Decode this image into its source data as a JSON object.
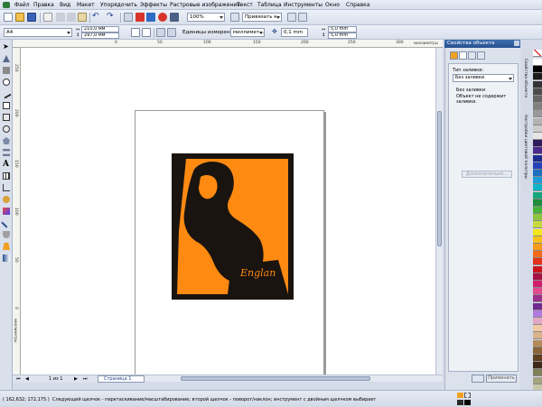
{
  "menu": [
    "Файл",
    "Правка",
    "Вид",
    "Макет",
    "Упорядочить",
    "Эффекты",
    "Растровые изображения",
    "Текст",
    "Таблица",
    "Инструменты",
    "Окно",
    "Справка"
  ],
  "toolbar": {
    "zoom": "100%",
    "snap": "Привязать к"
  },
  "propbar": {
    "page_size": "A4",
    "width": "210,0 мм",
    "height": "297,0 мм",
    "units_label": "Единицы измерения:",
    "units": "миллимет...",
    "nudge": "0,1 mm",
    "dup_x": "5,0 mm",
    "dup_y": "5,0 mm"
  },
  "ruler": {
    "h_labels": [
      "0",
      "50",
      "100",
      "150",
      "200",
      "250",
      "300"
    ],
    "h_unit": "миллиметры",
    "v_labels": [
      "250",
      "200",
      "150",
      "100",
      "50",
      "0"
    ],
    "v_unit": "миллиметры"
  },
  "docker": {
    "title": "Свойства объекта",
    "fill_type_label": "Тип заливки:",
    "fill_type": "Без заливки",
    "fill_note_title": "Без заливки",
    "fill_note": "Объект не содержит заливки.",
    "more_button": "Дополнительно...",
    "apply_button": "Применить"
  },
  "vtabs": [
    "Свойства объекта",
    "Настройки цветовой палитры"
  ],
  "pagenav": {
    "counter": "1 из 1",
    "tab": "Страница 1"
  },
  "status": {
    "coords": "( 162,632; 172,175 )",
    "hint": "Следующий щелчок - перетаскивание/масштабирование; второй щелчок - поворот/наклон; инструмент с двойным щелчком выбирает вс..."
  },
  "palette_colors": [
    "#ffffff",
    "#000000",
    "#1a1a1a",
    "#333333",
    "#4d4d4d",
    "#666666",
    "#808080",
    "#999999",
    "#b3b3b3",
    "#cccccc",
    "#e6e6e6",
    "#2e1a5c",
    "#4b2a8a",
    "#1d2b8f",
    "#2442b8",
    "#1f6fbf",
    "#1e9bd7",
    "#10b3c7",
    "#17a37b",
    "#1f8c3b",
    "#45b23a",
    "#8cc63f",
    "#c6d93c",
    "#f2e51a",
    "#f7c11a",
    "#f59a1b",
    "#ef6b1a",
    "#e5321b",
    "#c8151b",
    "#a51244",
    "#cf1f6c",
    "#e04b8e",
    "#9b2f8c",
    "#6e2a8c",
    "#b07be0",
    "#e3a7c4",
    "#f2c9a6",
    "#d9b48a",
    "#b38a5a",
    "#8a6337",
    "#5e3f22",
    "#3c2a16",
    "#7f7f5a",
    "#a3a380",
    "#c8c8a8"
  ]
}
